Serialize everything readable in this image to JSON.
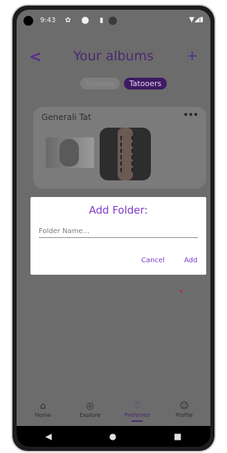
{
  "status": {
    "time": "9:43",
    "left_icons": "✿ ⬤ ▮",
    "right_icons": "▼◢▮"
  },
  "header": {
    "back": "<",
    "title": "Your albums",
    "add": "+"
  },
  "toggle": {
    "studios": "Studios",
    "tatooers": "Tatooers"
  },
  "album": {
    "title": "Generali Tat",
    "menu": "•••"
  },
  "dialog": {
    "title": "Add Folder:",
    "placeholder": "Folder Name...",
    "cancel": "Cancel",
    "add": "Add"
  },
  "nav": [
    {
      "label": "Home",
      "icon": "⌂"
    },
    {
      "label": "Explore",
      "icon": "◎"
    },
    {
      "label": "Preferred",
      "icon": "♡"
    },
    {
      "label": "Profile",
      "icon": "☺"
    }
  ],
  "system_nav": {
    "back": "◀",
    "home": "●",
    "recents": "■"
  },
  "colors": {
    "accent": "#7e3bc7",
    "title": "#4a2a70",
    "overlay": "#6c6c6c"
  }
}
